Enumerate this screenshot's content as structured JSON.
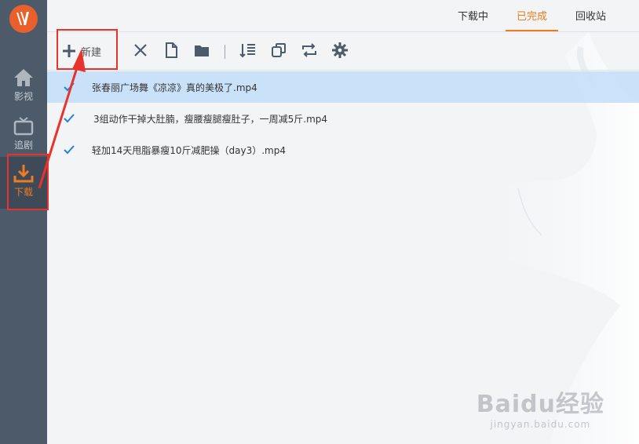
{
  "sidebar": {
    "items": [
      {
        "label": "影视",
        "icon": "home-icon"
      },
      {
        "label": "追剧",
        "icon": "tv-icon"
      },
      {
        "label": "下载",
        "icon": "download-icon"
      }
    ],
    "active_color": "#f07c20"
  },
  "tabs": [
    {
      "label": "下载中"
    },
    {
      "label": "已完成"
    },
    {
      "label": "回收站"
    }
  ],
  "active_tab": "已完成",
  "toolbar": {
    "new_label": "新建",
    "icons": [
      "plus-icon",
      "close-icon",
      "file-icon",
      "folder-icon",
      "sort-icon",
      "copy-icon",
      "repeat-icon",
      "gear-icon"
    ]
  },
  "downloads": [
    {
      "name": "张春丽广场舞《凉凉》真的美极了.mp4"
    },
    {
      "name": "3组动作干掉大肚腩，瘦腰瘦腿瘦肚子，一周减5斤.mp4"
    },
    {
      "name": "轻加14天甩脂暴瘦10斤减肥操（day3）.mp4"
    }
  ],
  "watermark": {
    "main": "Baidu经验",
    "sub": "jingyan.baidu.com"
  },
  "colors": {
    "accent": "#ef7a1e",
    "sidebar": "#4d5a6a",
    "selected_row": "#c6e0fa",
    "check": "#2a7fd4",
    "annotation": "#e8332c"
  }
}
